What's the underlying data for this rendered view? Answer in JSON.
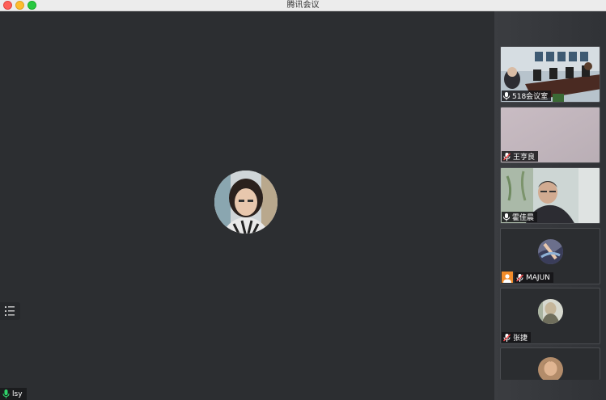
{
  "window": {
    "title": "腾讯会议"
  },
  "main": {
    "speaker_name": "lsy"
  },
  "participants": [
    {
      "name": "518会议室",
      "mic": "on"
    },
    {
      "name": "王亨良",
      "mic": "muted"
    },
    {
      "name": "霍佳晨",
      "mic": "on"
    },
    {
      "name": "MAJUN",
      "mic": "muted"
    },
    {
      "name": "张捷",
      "mic": "muted"
    }
  ],
  "colors": {
    "mic_on": "#2fd46a",
    "mic_muted": "#ff4d4f",
    "host_badge": "#f28c2a",
    "stage_bg": "#2c2e31"
  }
}
